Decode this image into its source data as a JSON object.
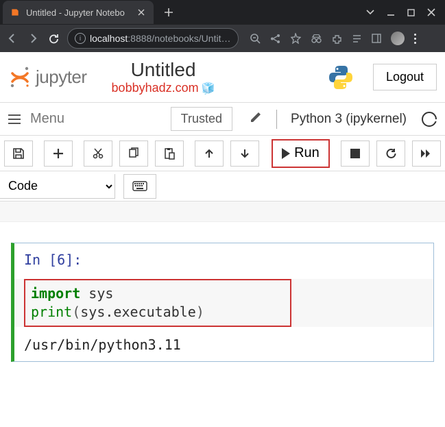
{
  "browser": {
    "tab_title": "Untitled - Jupyter Notebo",
    "url_host": "localhost",
    "url_port_path": ":8888/notebooks/Untit…"
  },
  "header": {
    "logo_text": "jupyter",
    "notebook_title": "Untitled",
    "watermark": "bobbyhadz.com",
    "logout": "Logout"
  },
  "menubar": {
    "menu_label": "Menu",
    "trusted": "Trusted",
    "kernel": "Python 3 (ipykernel)"
  },
  "toolbar": {
    "run_label": "Run"
  },
  "celltype": {
    "value": "Code"
  },
  "cell": {
    "prompt": "In [6]:",
    "code_kw_import": "import",
    "code_var_sys1": " sys",
    "code_fn_print": "print",
    "code_open": "(",
    "code_var_sysexec": "sys.executable",
    "code_close": ")",
    "output": "/usr/bin/python3.11"
  }
}
